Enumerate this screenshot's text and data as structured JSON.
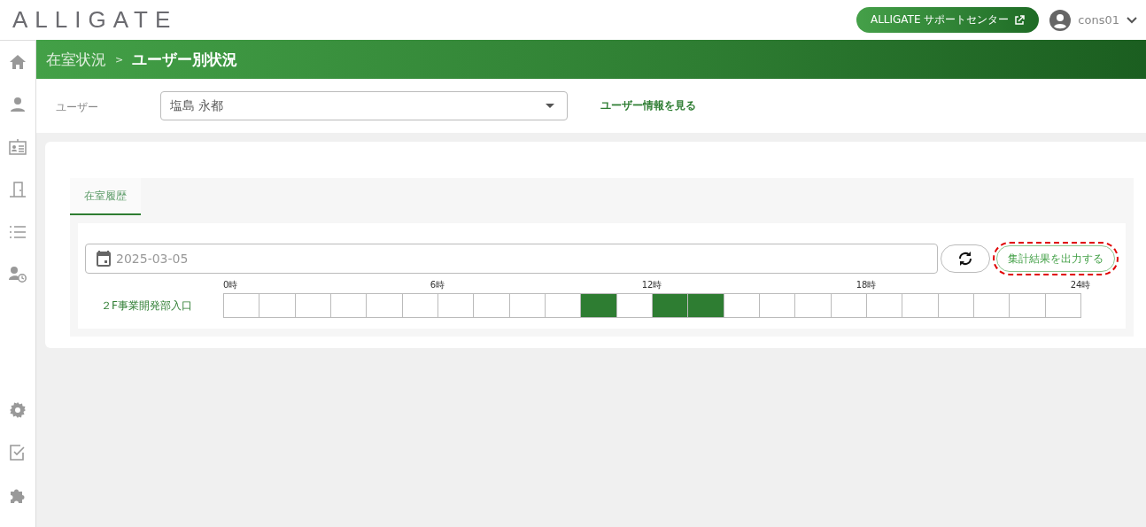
{
  "header": {
    "logo": "ALLIGATE",
    "support_button": "ALLIGATE サポートセンター",
    "user": "cons01"
  },
  "sidebar": {
    "items": [
      {
        "kind": "home",
        "selected": false
      },
      {
        "kind": "person",
        "selected": false
      },
      {
        "kind": "card",
        "selected": false
      },
      {
        "kind": "door",
        "selected": false
      },
      {
        "kind": "list",
        "selected": false
      },
      {
        "kind": "history",
        "selected": false
      }
    ],
    "bottom_items": [
      {
        "kind": "settings"
      },
      {
        "kind": "check"
      },
      {
        "kind": "puzzle"
      }
    ]
  },
  "breadcrumb": {
    "parent": "在室状況",
    "separator": ">",
    "current": "ユーザー別状況"
  },
  "user_filter": {
    "label": "ユーザー",
    "value": "塩島 永都",
    "link": "ユーザー情報を見る"
  },
  "tabs": [
    {
      "label": "在室履歴",
      "selected": true
    }
  ],
  "date_field": {
    "value": "2025-03-05"
  },
  "export_button": {
    "label": "集計結果を出力する",
    "highlighted": true
  },
  "timeline": {
    "ticks": [
      "0時",
      "6時",
      "12時",
      "18時",
      "24時"
    ],
    "rows": [
      {
        "label": "２F事業開発部入口",
        "hours": [
          false,
          false,
          false,
          false,
          false,
          false,
          false,
          false,
          false,
          false,
          true,
          false,
          true,
          true,
          false,
          false,
          false,
          false,
          false,
          false,
          false,
          false,
          false,
          false
        ]
      }
    ]
  }
}
